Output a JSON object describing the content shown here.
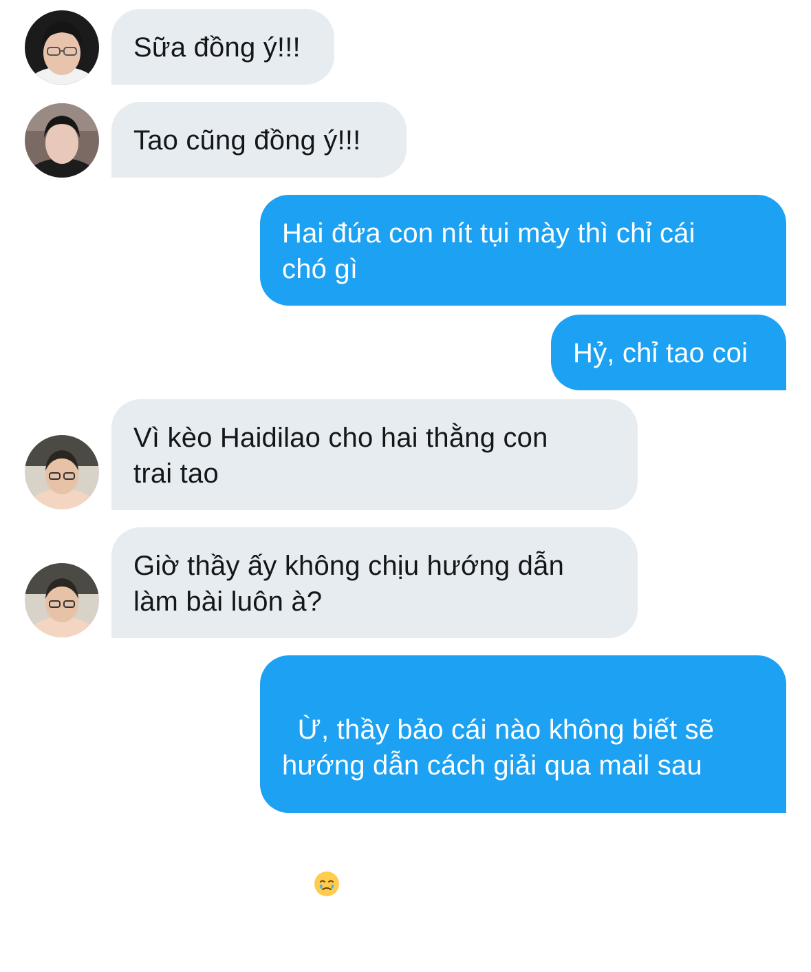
{
  "conversation": {
    "messages": [
      {
        "sender": "incoming",
        "text": "Sữa đồng ý!!!"
      },
      {
        "sender": "incoming",
        "text": "Tao cũng đồng ý!!!"
      },
      {
        "sender": "outgoing",
        "text": "Hai đứa con nít tụi mày thì chỉ cái\nchó gì"
      },
      {
        "sender": "outgoing",
        "text": "Hỷ, chỉ tao coi"
      },
      {
        "sender": "incoming",
        "text": "Vì kèo Haidilao cho hai thằng con\ntrai tao"
      },
      {
        "sender": "incoming",
        "text": "Giờ thầy ấy không chịu hướng dẫn\nlàm bài luôn à?"
      },
      {
        "sender": "outgoing",
        "text": "Ừ, thầy bảo cái nào không biết sẽ\nhướng dẫn cách giải qua mail sau"
      }
    ],
    "last_message_emoji": "face-holding-back-tears-emoji"
  },
  "colors": {
    "incoming_bubble": "#e6ecf0",
    "outgoing_bubble": "#1da1f2",
    "incoming_text": "#14171a",
    "outgoing_text": "#ffffff"
  }
}
